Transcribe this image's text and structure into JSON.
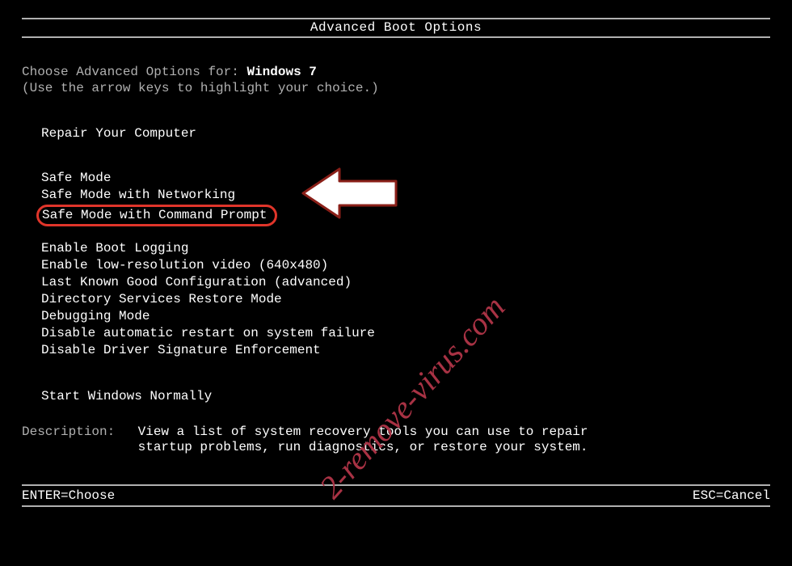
{
  "header": {
    "title": "Advanced Boot Options"
  },
  "intro": {
    "prefix": "Choose Advanced Options for: ",
    "os": "Windows 7",
    "hint": "(Use the arrow keys to highlight your choice.)"
  },
  "menu": {
    "group1": [
      "Repair Your Computer"
    ],
    "group2": [
      "Safe Mode",
      "Safe Mode with Networking",
      "Safe Mode with Command Prompt"
    ],
    "group3": [
      "Enable Boot Logging",
      "Enable low-resolution video (640x480)",
      "Last Known Good Configuration (advanced)",
      "Directory Services Restore Mode",
      "Debugging Mode",
      "Disable automatic restart on system failure",
      "Disable Driver Signature Enforcement"
    ],
    "group4": [
      "Start Windows Normally"
    ],
    "highlighted_index": {
      "group": 2,
      "item": 2
    }
  },
  "description": {
    "label": "Description:",
    "text": "View a list of system recovery tools you can use to repair startup problems, run diagnostics, or restore your system."
  },
  "footer": {
    "left": "ENTER=Choose",
    "right": "ESC=Cancel"
  },
  "annotation": {
    "arrow_target": "Safe Mode with Command Prompt",
    "highlight_color": "#e0352a"
  },
  "watermark": {
    "text": "2-remove-virus.com"
  }
}
